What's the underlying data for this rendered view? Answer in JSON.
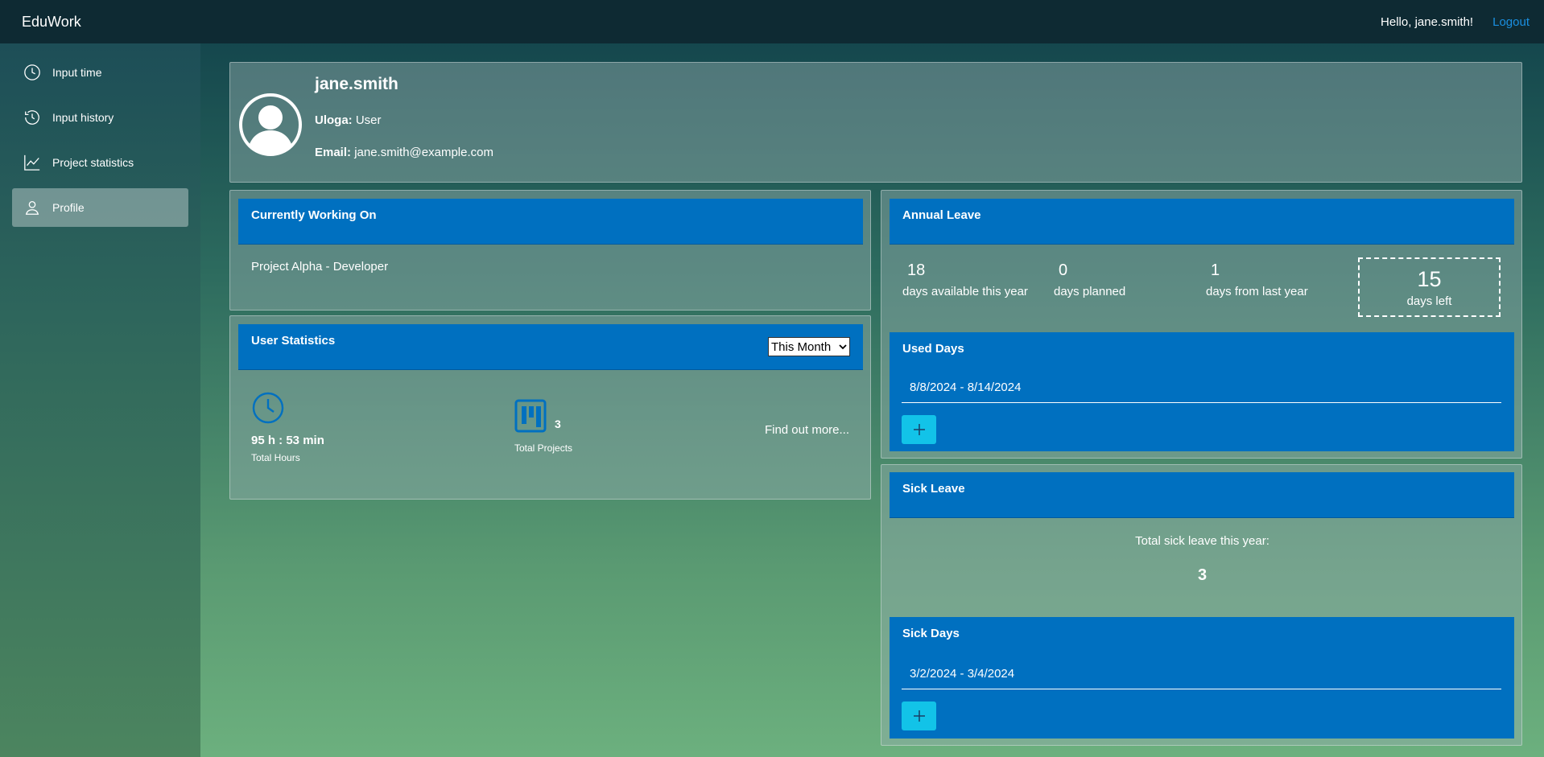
{
  "app": {
    "title": "EduWork"
  },
  "header": {
    "greeting": "Hello, jane.smith!",
    "logout": "Logout"
  },
  "sidebar": {
    "items": [
      {
        "label": "Input time",
        "icon": "clock-icon"
      },
      {
        "label": "Input history",
        "icon": "history-icon"
      },
      {
        "label": "Project statistics",
        "icon": "chart-line-icon"
      },
      {
        "label": "Profile",
        "icon": "user-icon",
        "active": true
      }
    ]
  },
  "profile": {
    "username": "jane.smith",
    "role_label": "Uloga:",
    "role": "User",
    "email_label": "Email:",
    "email": "jane.smith@example.com"
  },
  "working": {
    "title": "Currently Working On",
    "project": "Project Alpha - Developer"
  },
  "stats": {
    "title": "User Statistics",
    "period": "This Month",
    "hours_value": "95 h : 53 min",
    "hours_label": "Total Hours",
    "projects_value": "3",
    "projects_label": "Total Projects",
    "find_more": "Find out more..."
  },
  "annual": {
    "title": "Annual Leave",
    "available": "18",
    "available_label": "days available this year",
    "planned": "0",
    "planned_label": "days planned",
    "last_year": "1",
    "last_year_label": "days from last year",
    "left": "15",
    "left_label": "days left",
    "used_title": "Used Days",
    "used_range": "8/8/2024 - 8/14/2024"
  },
  "sick": {
    "title": "Sick Leave",
    "total_label": "Total sick leave this year:",
    "total": "3",
    "days_title": "Sick Days",
    "days_range": "3/2/2024 - 3/4/2024"
  },
  "colors": {
    "accent": "#0070c0",
    "button": "#12c3e8",
    "topbar": "#0e2a33",
    "link": "#1a8fe0"
  }
}
